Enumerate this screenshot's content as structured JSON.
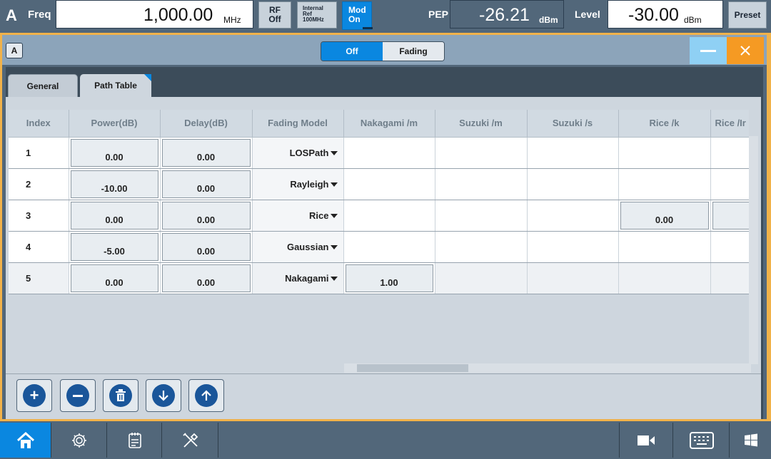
{
  "topbar": {
    "instance": "A",
    "freq_label": "Freq",
    "freq_value": "1,000.00",
    "freq_unit": "MHz",
    "rf_label": "RF",
    "rf_state": "Off",
    "ref_line1": "Internal",
    "ref_line2": "Ref",
    "ref_line3": "100MHz",
    "mod_label": "Mod",
    "mod_state": "On",
    "pep_label": "PEP",
    "pep_value": "-26.21",
    "pep_unit": "dBm",
    "level_label": "Level",
    "level_value": "-30.00",
    "level_unit": "dBm",
    "preset_label": "Preset"
  },
  "dialog": {
    "channel_badge": "A",
    "toggle_off": "Off",
    "toggle_on": "Fading",
    "tabs": [
      "General",
      "Path Table"
    ],
    "columns": [
      "Index",
      "Power(dB)",
      "Delay(dB)",
      "Fading Model",
      "Nakagami /m",
      "Suzuki /m",
      "Suzuki /s",
      "Rice /k",
      "Rice /Ir"
    ],
    "rows": [
      {
        "index": "1",
        "power": "0.00",
        "delay": "0.00",
        "model": "LOSPath"
      },
      {
        "index": "2",
        "power": "-10.00",
        "delay": "0.00",
        "model": "Rayleigh"
      },
      {
        "index": "3",
        "power": "0.00",
        "delay": "0.00",
        "model": "Rice",
        "rice_k": "0.00"
      },
      {
        "index": "4",
        "power": "-5.00",
        "delay": "0.00",
        "model": "Gaussian"
      },
      {
        "index": "5",
        "power": "0.00",
        "delay": "0.00",
        "model": "Nakagami",
        "nakagami_m": "1.00"
      }
    ]
  },
  "colors": {
    "accent": "#f1b24a",
    "active_blue": "#0a87e0",
    "button_blue": "#1a569a",
    "close_orange": "#f59a23"
  }
}
